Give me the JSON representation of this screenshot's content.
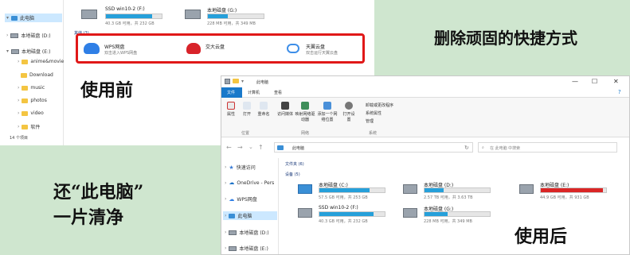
{
  "captions": {
    "title": "删除顽固的快捷方式",
    "before": "使用前",
    "restore_line1": "还“此电脑”",
    "restore_line2": "一片清净",
    "after": "使用后"
  },
  "before_window": {
    "sidebar": [
      "此电脑",
      "本地磁盘 (D:)",
      "本地磁盘 (E:)",
      "anime&movie",
      "Download",
      "music",
      "photos",
      "video",
      "软件"
    ],
    "status": "14 个项目",
    "drive_top": {
      "name": "SSD win10-2 (F:)",
      "free": "40.3 GB 可用，共 232 GB",
      "fill": 0.83
    },
    "drive_top2": {
      "name": "本地磁盘 (G:)",
      "free": "228 MB 可用，共 349 MB",
      "fill": 0.35
    },
    "group_label": "其他 (3)",
    "shortcuts": [
      {
        "name": "WPS网盘",
        "desc": "双击进入WPS网盘"
      },
      {
        "name": "交大云盘",
        "desc": ""
      },
      {
        "name": "天翼云盘",
        "desc": "双击运行天翼云盘"
      }
    ]
  },
  "after_window": {
    "title": "此电脑",
    "tabs": [
      "文件",
      "计算机",
      "查看"
    ],
    "ribbon": [
      "属性",
      "打开",
      "重命名",
      "访问媒体",
      "映射网络驱动器",
      "添加一个网络位置",
      "打开设置"
    ],
    "ribbon_right": [
      "卸载或更改程序",
      "系统属性",
      "管理"
    ],
    "groups": [
      "位置",
      "网络",
      "系统"
    ],
    "address": "此电脑",
    "search_placeholder": "在 此电脑 中搜索",
    "sidebar": [
      "快速访问",
      "OneDrive - Pers",
      "WPS网盘",
      "此电脑",
      "本地磁盘 (D:)",
      "本地磁盘 (E:)"
    ],
    "section_folders": "文件夹 (6)",
    "section_devices": "设备 (5)",
    "drives": [
      {
        "name": "本地磁盘 (C:)",
        "free": "57.5 GB 可用，共 253 GB",
        "fill": 0.77,
        "color": "#26a0da"
      },
      {
        "name": "本地磁盘 (D:)",
        "free": "2.57 TB 可用，共 3.63 TB",
        "fill": 0.29,
        "color": "#26a0da"
      },
      {
        "name": "本地磁盘 (E:)",
        "free": "44.9 GB 可用，共 931 GB",
        "fill": 0.95,
        "color": "#da2626"
      },
      {
        "name": "SSD win10-2 (F:)",
        "free": "40.3 GB 可用，共 232 GB",
        "fill": 0.83,
        "color": "#26a0da"
      },
      {
        "name": "本地磁盘 (G:)",
        "free": "228 MB 可用，共 349 MB",
        "fill": 0.35,
        "color": "#26a0da"
      }
    ]
  }
}
